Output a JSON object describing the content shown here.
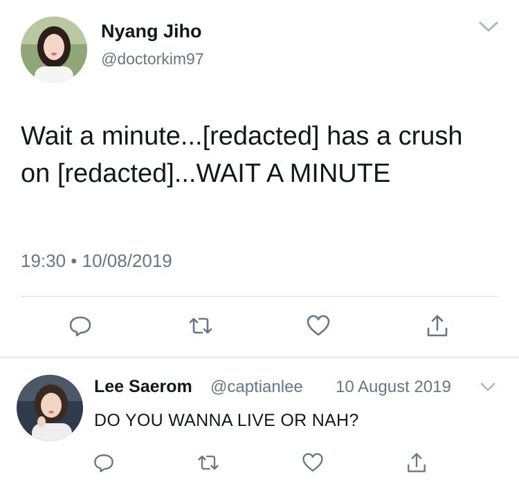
{
  "tweet": {
    "author_name": "Nyang Jiho",
    "author_handle": "@doctorkim97",
    "text": "Wait a minute...[redacted] has a crush on [redacted]...WAIT A MINUTE",
    "timestamp": "19:30 • 10/08/2019"
  },
  "reply": {
    "author_name": "Lee Saerom",
    "author_handle": "@captianlee",
    "date": "10 August 2019",
    "text": "DO YOU WANNA LIVE OR NAH?"
  },
  "icons": {
    "menu": "chevron-down-icon",
    "reply": "reply-icon",
    "retweet": "retweet-icon",
    "like": "heart-icon",
    "share": "share-icon"
  },
  "colors": {
    "text_primary": "#14171a",
    "text_secondary": "#657786",
    "divider": "#d4d9dd",
    "icon": "#657786"
  }
}
